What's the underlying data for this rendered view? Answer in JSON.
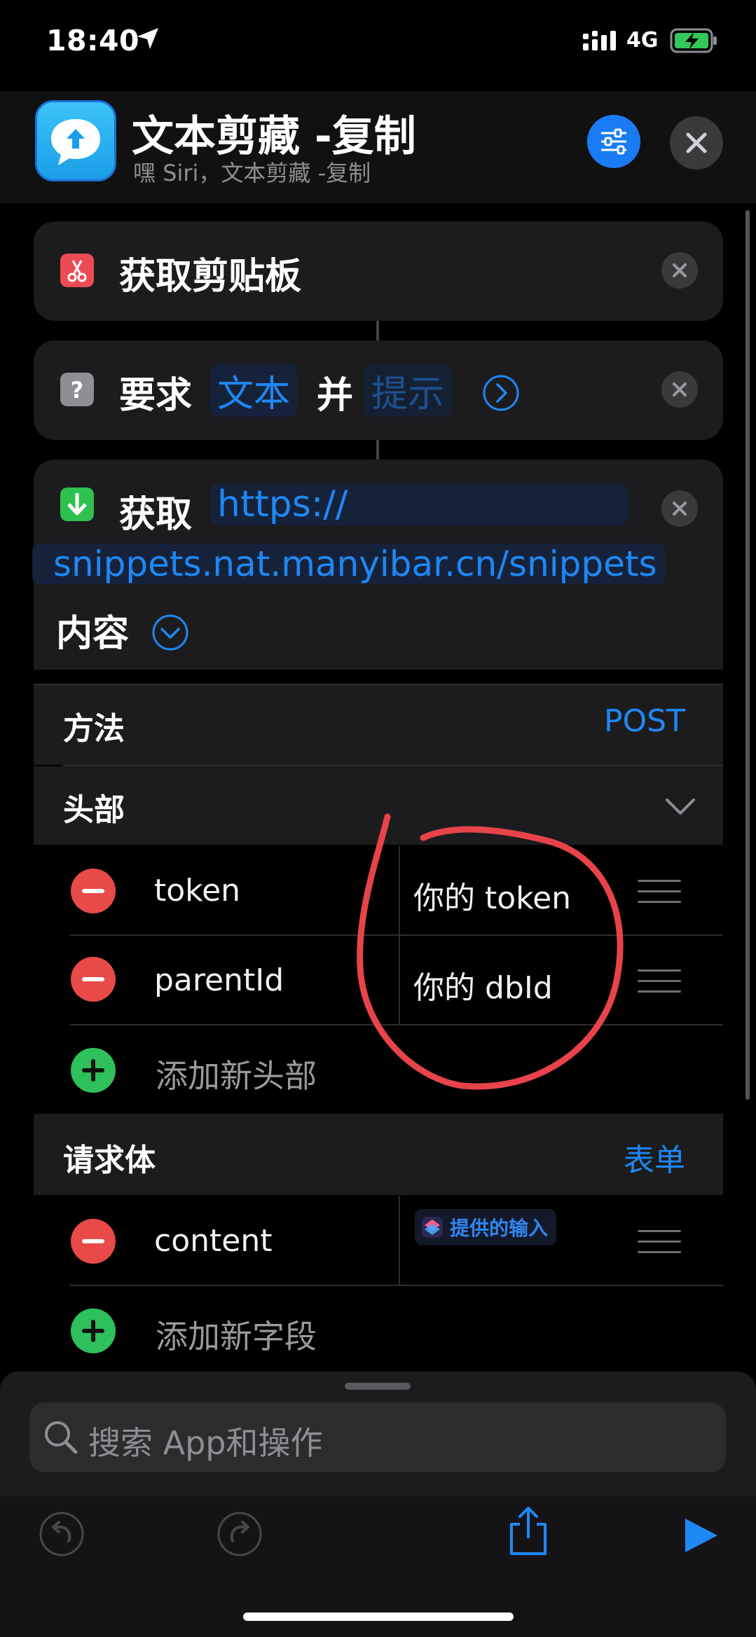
{
  "status_bar": {
    "time": "18:40",
    "network": "4G"
  },
  "header": {
    "title": "文本剪藏 -复制",
    "subtitle": "嘿 Siri，文本剪藏 -复制"
  },
  "actions": {
    "get_clipboard": {
      "label": "获取剪贴板"
    },
    "ask_input": {
      "prefix": "要求",
      "type": "文本",
      "and": "并",
      "prompt": "提示"
    },
    "get_contents": {
      "verb": "获取",
      "url_part1": "https://",
      "url_part2": "snippets.nat.manyibar.cn/snippets",
      "suffix": "内容",
      "method_label": "方法",
      "method_value": "POST",
      "headers_label": "头部",
      "headers": [
        {
          "key": "token",
          "value": "你的 token"
        },
        {
          "key": "parentId",
          "value": "你的 dbId"
        }
      ],
      "add_header": "添加新头部",
      "body_label": "请求体",
      "body_value": "表单",
      "fields": [
        {
          "key": "content",
          "value": "提供的输入"
        }
      ],
      "add_field": "添加新字段"
    }
  },
  "search": {
    "placeholder": "搜索 App和操作"
  },
  "colors": {
    "accent": "#1e88f5",
    "destructive": "#e84a47",
    "add": "#2ec05a",
    "annotation": "#e8434a"
  },
  "icons": {
    "clipboard": "scissors-icon",
    "ask": "question-icon",
    "download": "download-arrow-icon",
    "settings": "sliders-icon",
    "close": "close-icon",
    "undo": "undo-icon",
    "redo": "redo-icon",
    "share": "share-icon",
    "run": "play-icon"
  }
}
